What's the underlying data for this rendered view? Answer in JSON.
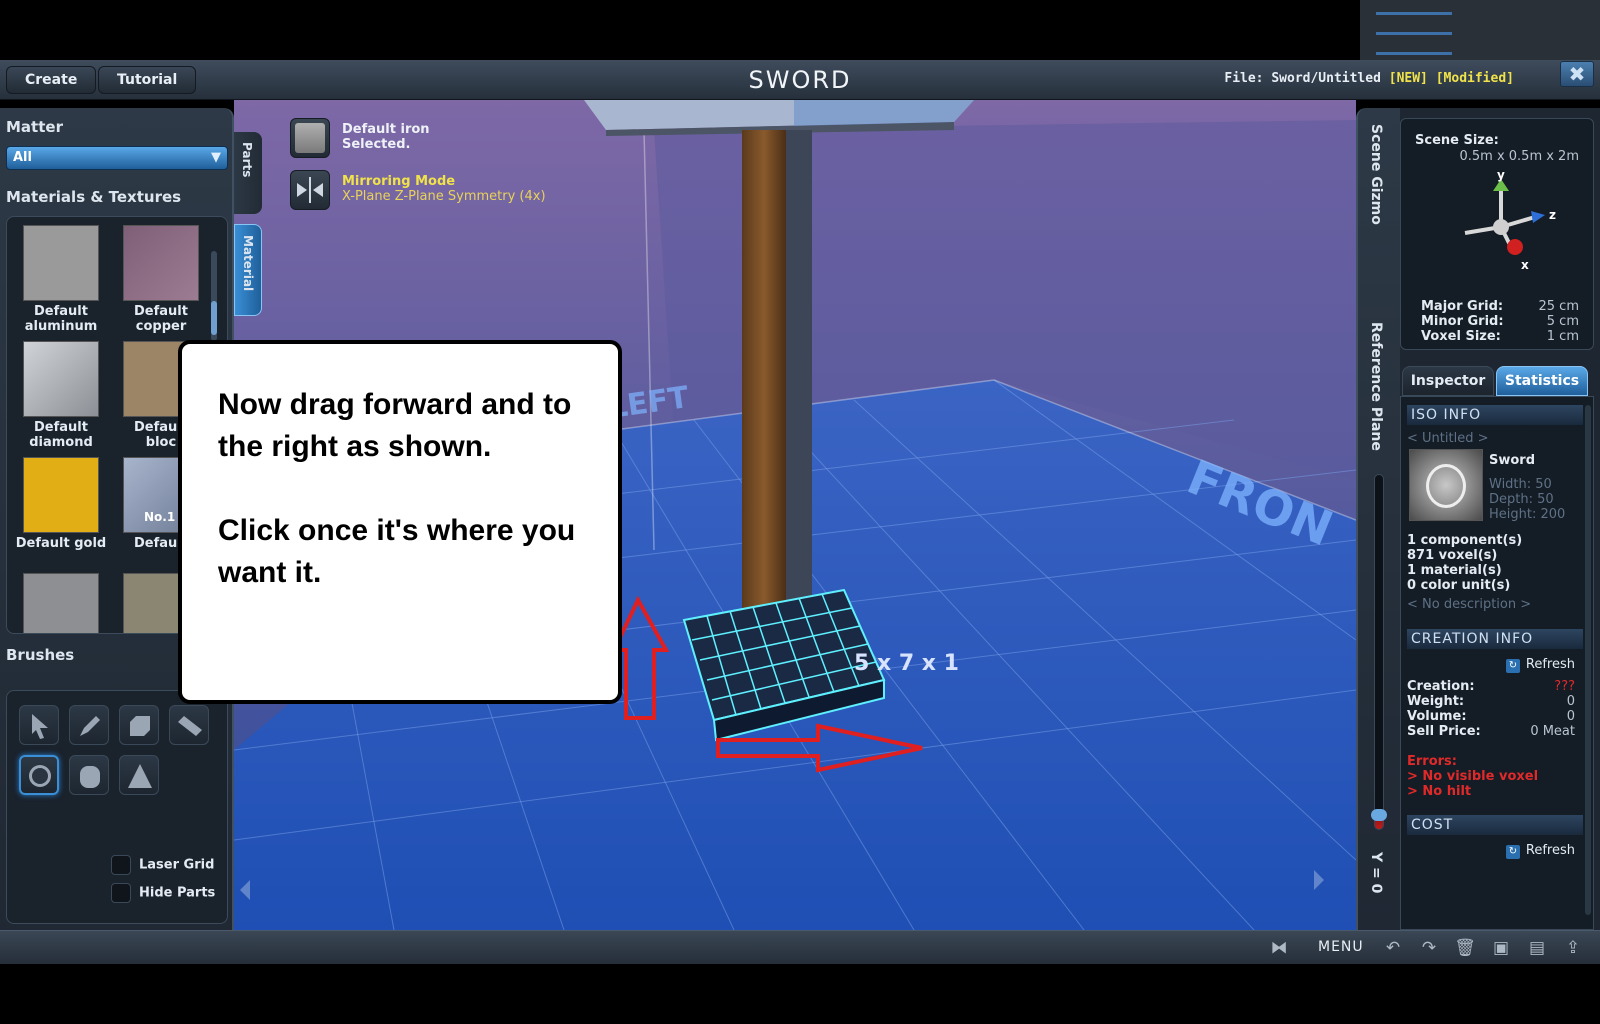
{
  "titlebar": {
    "create_label": "Create",
    "tutorial_label": "Tutorial",
    "app_title": "SWORD",
    "file_prefix": "File:",
    "file_path": "Sword/Untitled",
    "tag_new": "[NEW]",
    "tag_modified": "[Modified]"
  },
  "left_panel": {
    "matter_title": "Matter",
    "matter_selected": "All",
    "materials_title": "Materials & Textures",
    "materials": [
      {
        "line1": "Default",
        "line2": "aluminum",
        "color": "#9a9a9a"
      },
      {
        "line1": "Default",
        "line2": "copper",
        "color": "#8c6b80"
      },
      {
        "line1": "Default",
        "line2": "diamond",
        "color": "#b8bcc0"
      },
      {
        "line1": "Default",
        "line2": "bloc",
        "color": "#9c8466"
      },
      {
        "line1": "Default gold",
        "line2": "",
        "color": "#e2ae16"
      },
      {
        "line1": "Default",
        "line2": "",
        "color": "#8a97b0"
      }
    ],
    "material_overlay": "No.1",
    "brushes_title": "Brushes",
    "laser_grid_label": "Laser Grid",
    "hide_parts_label": "Hide Parts",
    "tab_parts": "Parts",
    "tab_material": "Material"
  },
  "viewport": {
    "selected_line1": "Default iron",
    "selected_line2": "Selected.",
    "mirror_title": "Mirroring Mode",
    "mirror_desc": "X-Plane Z-Plane Symmetry (4x)",
    "label_left": "LEFT",
    "label_front": "FRON",
    "dims_label": "5 x 7 x 1"
  },
  "callout": {
    "line1": "Now drag forward and to the right as shown.",
    "line2": "Click once it's where you want it."
  },
  "right_side": {
    "scene_gizmo": "Scene Gizmo",
    "reference_plane": "Reference Plane",
    "y_value": "Y = 0",
    "slider_level": 0.04
  },
  "right_panel": {
    "scene_size_label": "Scene Size:",
    "scene_size_value": "0.5m x 0.5m x 2m",
    "axis_y": "y",
    "axis_z": "z",
    "axis_x": "x",
    "major_grid_label": "Major Grid:",
    "major_grid_value": "25 cm",
    "minor_grid_label": "Minor Grid:",
    "minor_grid_value": "5 cm",
    "voxel_size_label": "Voxel Size:",
    "voxel_size_value": "1 cm",
    "tab_inspector": "Inspector",
    "tab_statistics": "Statistics",
    "iso_info": "ISO INFO",
    "untitled": "< Untitled >",
    "item_name": "Sword",
    "width": "Width: 50",
    "depth": "Depth: 50",
    "height": "Height: 200",
    "components": "1 component(s)",
    "voxels": "871 voxel(s)",
    "materials": "1 material(s)",
    "color_units": "0 color unit(s)",
    "no_description": "< No description >",
    "creation_info": "CREATION INFO",
    "refresh": "Refresh",
    "creation_label": "Creation:",
    "creation_value": "???",
    "weight_label": "Weight:",
    "weight_value": "0",
    "volume_label": "Volume:",
    "volume_value": "0",
    "sell_price_label": "Sell Price:",
    "sell_price_value": "0 Meat",
    "errors_label": "Errors:",
    "error1": "> No visible voxel",
    "error2": "> No hilt",
    "cost": "COST",
    "refresh2": "Refresh"
  },
  "bottombar": {
    "menu_label": "MENU"
  },
  "colors": {
    "accent": "#3a8fd6",
    "highlight_yellow": "#f0e24a",
    "error_red": "#e02a2a",
    "callout_arrow": "#e02020"
  }
}
